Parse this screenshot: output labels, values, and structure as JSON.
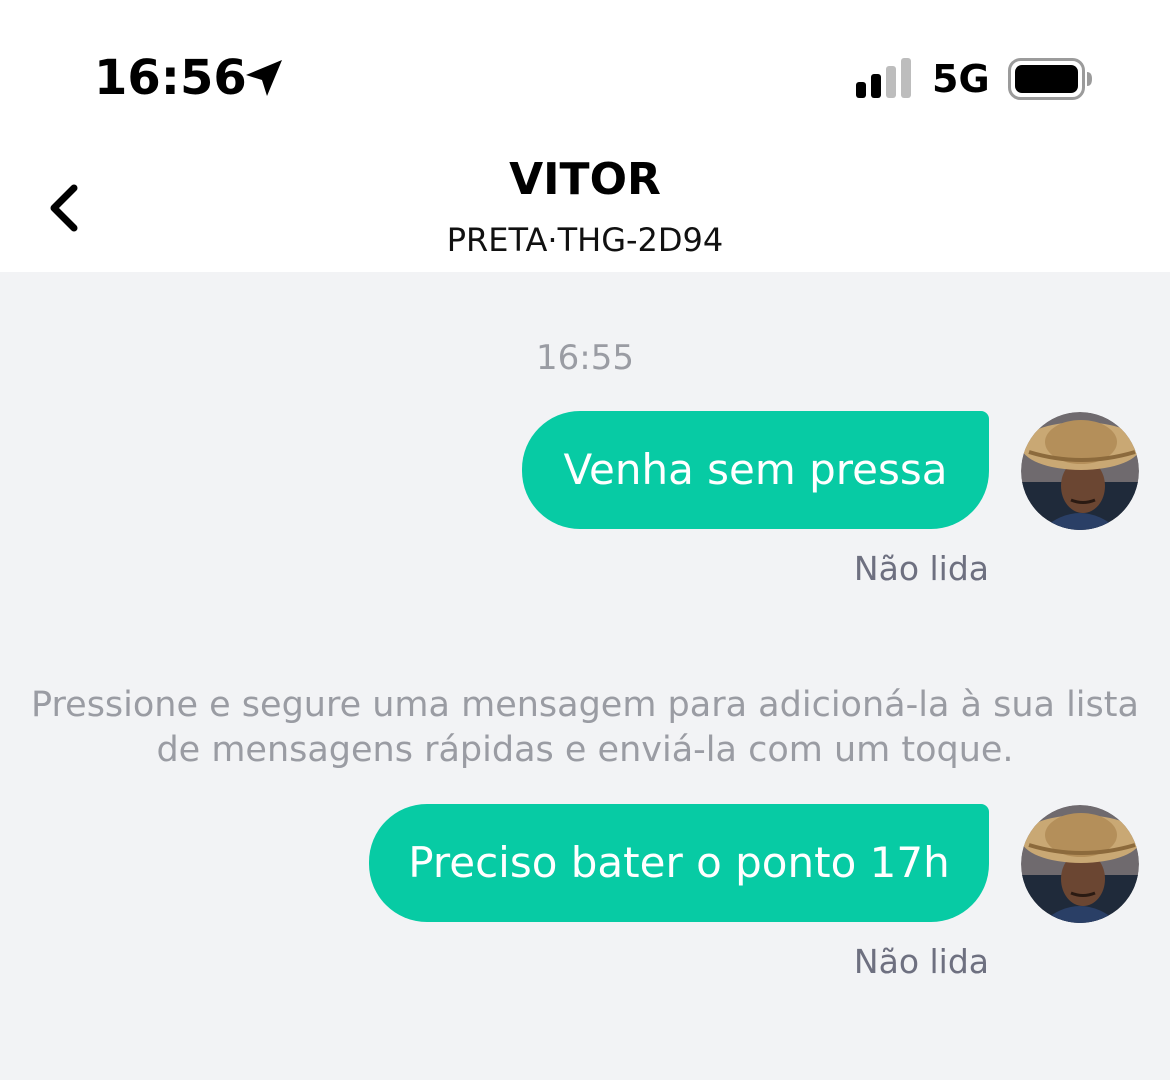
{
  "status_bar": {
    "time": "16:56",
    "network": "5G",
    "icons": [
      "location-arrow-icon",
      "signal-bars-icon",
      "battery-icon"
    ]
  },
  "header": {
    "back_icon": "chevron-left-icon",
    "contact_name": "VITOR",
    "vehicle_plate": "PRETA·THG-2D94"
  },
  "conversation": {
    "timestamp": "16:55",
    "messages": [
      {
        "text": "Venha sem pressa",
        "status": "Não lida",
        "sender": "self"
      },
      {
        "text": "Preciso bater o ponto 17h",
        "status": "Não lida",
        "sender": "self"
      }
    ],
    "hint": "Pressione e segure uma mensagem para adicioná-la à sua lista de mensagens rápidas e enviá-la com um toque."
  },
  "colors": {
    "bubble": "#07cba4",
    "background": "#f2f3f5",
    "header_background": "#ffffff",
    "muted_text": "#9a9ca3",
    "status_text": "#6e7080"
  }
}
